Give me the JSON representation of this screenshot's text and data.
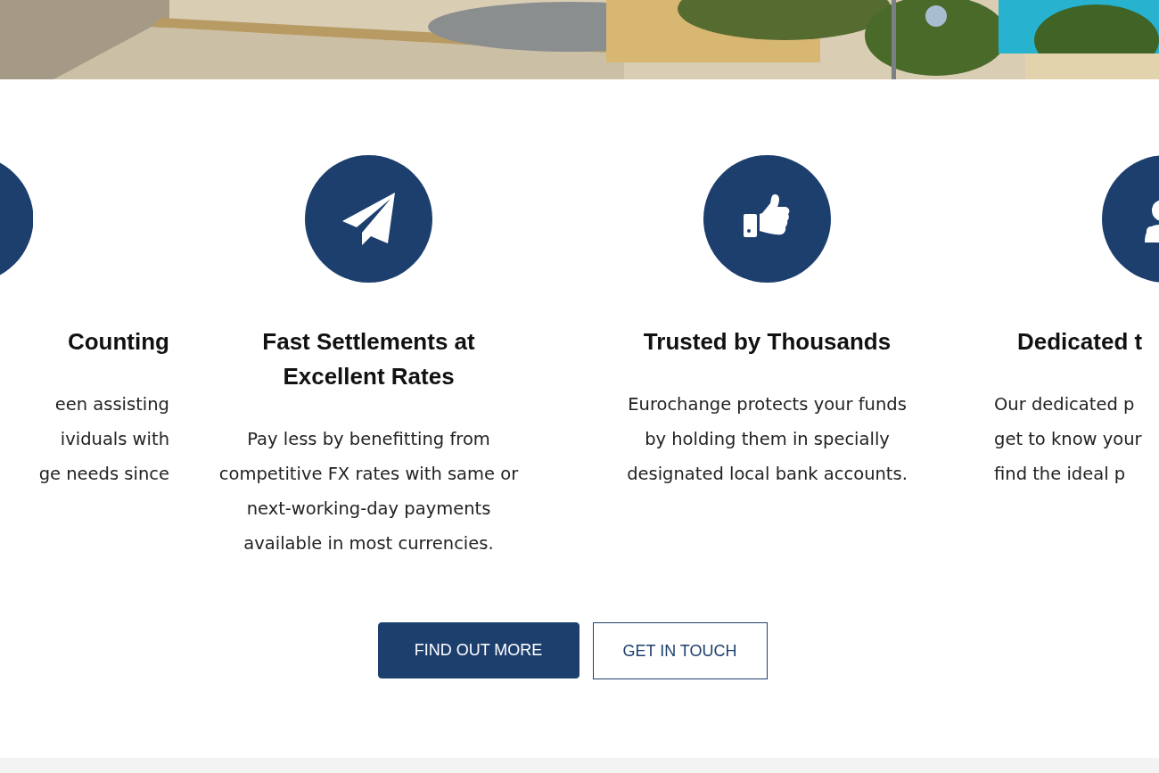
{
  "features": [
    {
      "kind": "cut-left",
      "title": [
        "Counting"
      ],
      "text": [
        "een assisting",
        "ividuals with",
        "ge needs since"
      ]
    },
    {
      "kind": "full",
      "title": [
        "Fast Settlements at",
        "Excellent Rates"
      ],
      "text": [
        "Pay less by benefitting from",
        "competitive FX rates with same or",
        "next-working-day payments",
        "available in most currencies."
      ]
    },
    {
      "kind": "full",
      "title": [
        "Trusted by Thousands"
      ],
      "text": [
        "Eurochange protects your funds",
        "by holding them in specially",
        "designated local bank accounts."
      ]
    },
    {
      "kind": "cut-right",
      "title": [
        "Dedicated t"
      ],
      "text": [
        "Our dedicated p",
        "get to know your",
        "find the ideal p"
      ]
    }
  ],
  "buttons": [
    {
      "label": "FIND OUT MORE",
      "kind": "primary"
    },
    {
      "label": "GET IN TOUCH",
      "kind": "outline"
    }
  ]
}
